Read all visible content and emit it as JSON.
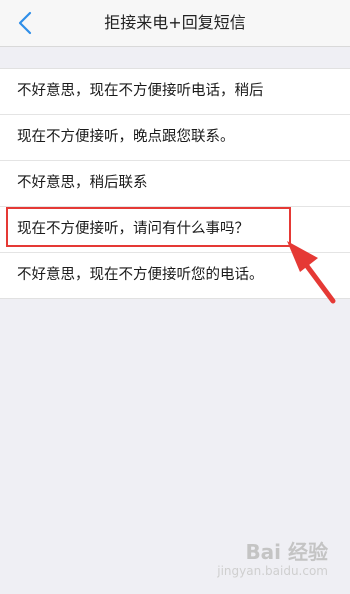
{
  "header": {
    "title": "拒接来电+回复短信",
    "back_icon": "chevron-left-icon",
    "accent_color": "#2f8fe8"
  },
  "messages": [
    "不好意思，现在不方便接听电话，稍后",
    "现在不方便接听，晚点跟您联系。",
    "不好意思，稍后联系",
    "现在不方便接听，请问有什么事吗？",
    "不好意思，现在不方便接听您的电话。"
  ],
  "annotation": {
    "color": "#e53935"
  },
  "watermark": {
    "brand": "Bai 经验",
    "url": "jingyan.baidu.com"
  }
}
